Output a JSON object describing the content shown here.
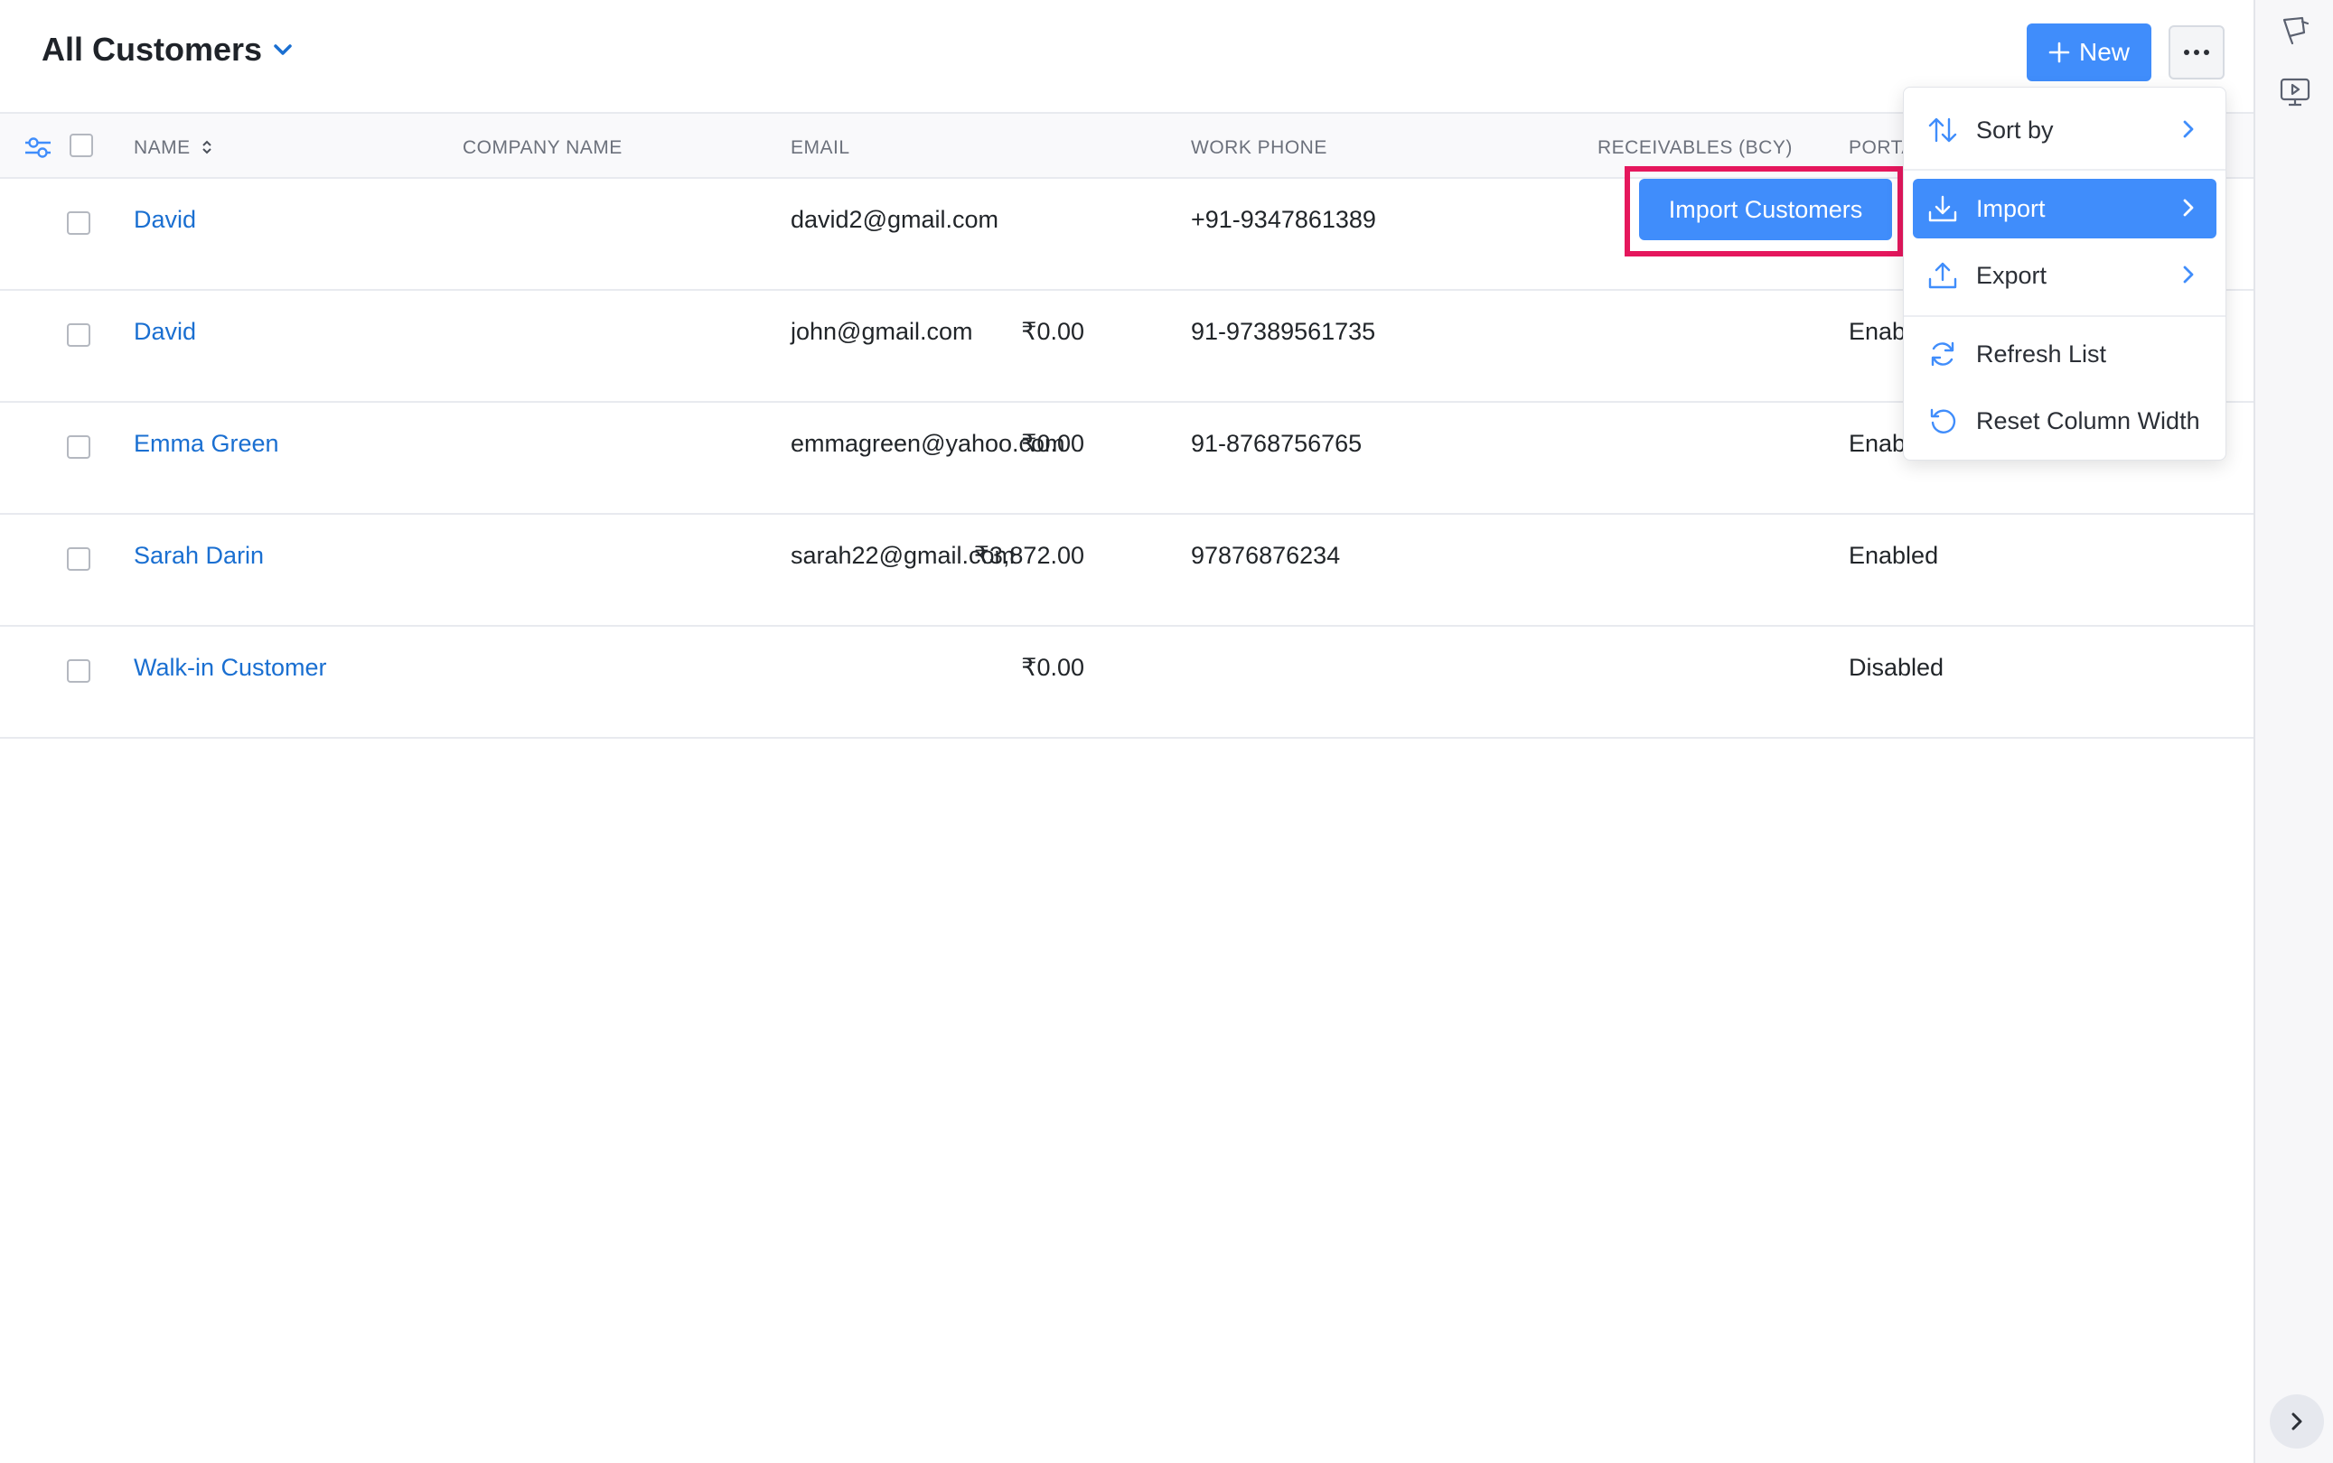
{
  "header": {
    "title": "All Customers",
    "new_label": "New"
  },
  "table": {
    "columns": [
      "NAME",
      "COMPANY NAME",
      "EMAIL",
      "WORK PHONE",
      "RECEIVABLES (BCY)",
      "PORTA"
    ],
    "rows": [
      {
        "name": "David",
        "company": "",
        "email": "david2@gmail.com",
        "phone": "+91-9347861389",
        "receivables": "",
        "portal": ""
      },
      {
        "name": "David",
        "company": "",
        "email": "john@gmail.com",
        "phone": "91-97389561735",
        "receivables": "₹0.00",
        "portal": "Enab"
      },
      {
        "name": "Emma Green",
        "company": "",
        "email": "emmagreen@yahoo.com",
        "phone": "91-8768756765",
        "receivables": "₹0.00",
        "portal": "Enab"
      },
      {
        "name": "Sarah Darin",
        "company": "",
        "email": "sarah22@gmail.com",
        "phone": "97876876234",
        "receivables": "₹3,872.00",
        "portal": "Enabled"
      },
      {
        "name": "Walk-in Customer",
        "company": "",
        "email": "",
        "phone": "",
        "receivables": "₹0.00",
        "portal": "Disabled"
      }
    ]
  },
  "menu": {
    "items": [
      {
        "label": "Sort by",
        "icon": "sort-arrows-icon",
        "has_submenu": true,
        "active": false
      },
      {
        "label": "Import",
        "icon": "download-icon",
        "has_submenu": true,
        "active": true
      },
      {
        "label": "Export",
        "icon": "upload-icon",
        "has_submenu": true,
        "active": false
      },
      {
        "label": "Refresh List",
        "icon": "refresh-icon",
        "has_submenu": false,
        "active": false
      },
      {
        "label": "Reset Column Width",
        "icon": "reset-icon",
        "has_submenu": false,
        "active": false
      }
    ],
    "submenu_label": "Import Customers"
  },
  "colors": {
    "accent": "#408dfb",
    "link": "#1a6fd1",
    "highlight_border": "#e5175d"
  }
}
